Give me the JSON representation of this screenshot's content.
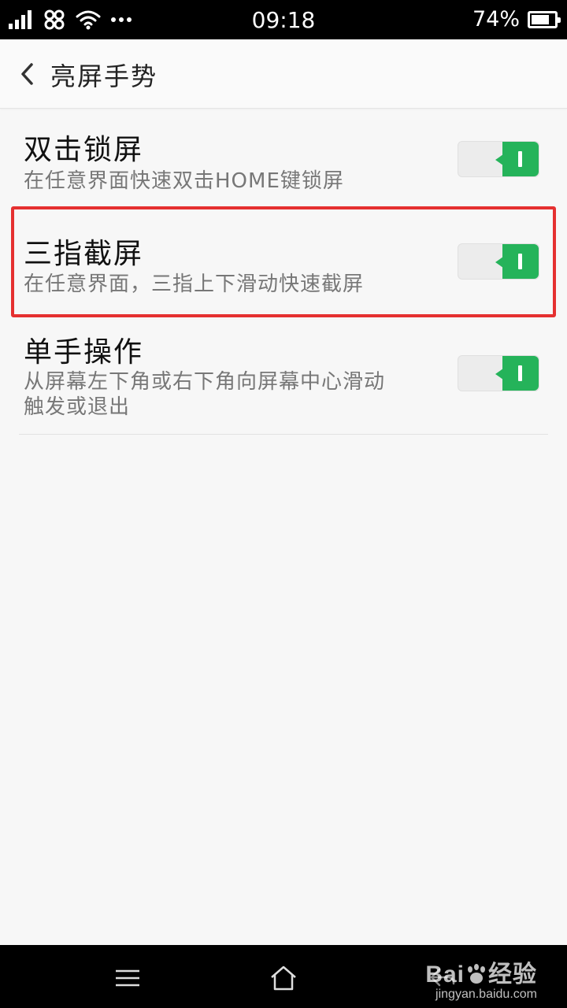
{
  "status_bar": {
    "time": "09:18",
    "battery_percent_label": "74%",
    "battery_level": 0.74,
    "icons": [
      "signal-icon",
      "unicom-icon",
      "wifi-icon",
      "more-icon"
    ]
  },
  "header": {
    "title": "亮屏手势",
    "back_icon": "chevron-left-icon"
  },
  "settings": [
    {
      "title": "双击锁屏",
      "subtitle": "在任意界面快速双击HOME键锁屏",
      "enabled": true
    },
    {
      "title": "三指截屏",
      "subtitle": "在任意界面，三指上下滑动快速截屏",
      "enabled": true,
      "highlighted": true
    },
    {
      "title": "单手操作",
      "subtitle_lines": [
        "从屏幕左下角或右下角向屏幕中心滑动",
        "触发或退出"
      ],
      "enabled": true
    }
  ],
  "colors": {
    "toggle_on": "#25b35a",
    "highlight": "#e53030"
  },
  "nav_bar": {
    "icons": [
      "menu-icon",
      "home-icon",
      "back-icon"
    ]
  },
  "watermark": {
    "brand": "Bai",
    "brand_cn": "经验",
    "url": "jingyan.baidu.com"
  }
}
